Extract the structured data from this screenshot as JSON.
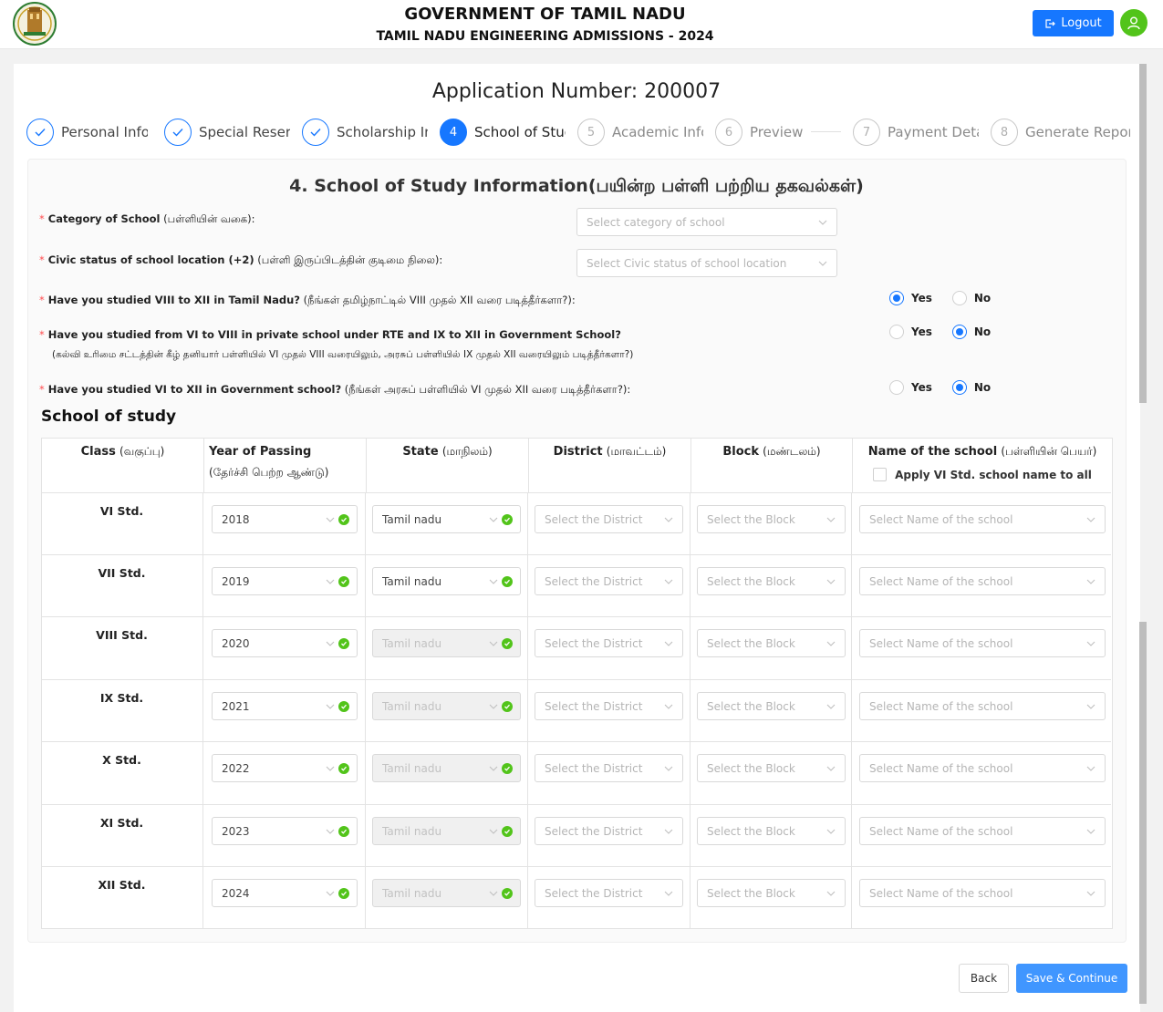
{
  "header": {
    "title": "GOVERNMENT OF TAMIL NADU",
    "subtitle": "TAMIL NADU ENGINEERING ADMISSIONS - 2024",
    "logout_label": "Logout"
  },
  "application_number": "Application Number: 200007",
  "steps": [
    {
      "number": "1",
      "label": "Personal Info",
      "status": "done"
    },
    {
      "number": "2",
      "label": "Special Reservation",
      "status": "done"
    },
    {
      "number": "3",
      "label": "Scholarship Info",
      "status": "done"
    },
    {
      "number": "4",
      "label": "School of Study",
      "status": "active"
    },
    {
      "number": "5",
      "label": "Academic Info",
      "status": "wait"
    },
    {
      "number": "6",
      "label": "Preview",
      "status": "wait"
    },
    {
      "number": "7",
      "label": "Payment Details",
      "status": "wait"
    },
    {
      "number": "8",
      "label": "Generate Report",
      "status": "wait"
    }
  ],
  "section_title": "4. School of Study Information(பயின்ற பள்ளி பற்றிய தகவல்கள்)",
  "questions": {
    "category": {
      "label_en": "Category of School",
      "label_ta": "(பள்ளியின் வகை):",
      "placeholder": "Select category of school"
    },
    "civic": {
      "label_en": "Civic status of school location (+2)",
      "label_ta": "(பள்ளி இருப்பிடத்தின் குடிமை நிலை):",
      "placeholder": "Select Civic status of school location"
    },
    "studied_tn": {
      "label_en": "Have you studied VIII to XII in Tamil Nadu?",
      "label_ta": "(நீங்கள் தமிழ்நாட்டில் VIII முதல் XII வரை படித்தீர்களா?):",
      "selected": "Yes"
    },
    "rte": {
      "label_en": "Have you studied from VI to VIII in private school under RTE and IX to XII in Government School?",
      "label_ta": "(கல்வி உரிமை சட்டத்தின் கீழ் தனியார் பள்ளியில் VI முதல் VIII வரையிலும், அரசுப் பள்ளியில் IX முதல் XII வரையிலும் படித்தீர்களா?)",
      "selected": "No"
    },
    "govt": {
      "label_en": "Have you studied VI to XII in Government school?",
      "label_ta": "(நீங்கள் அரசுப் பள்ளியில் VI முதல் XII வரை படித்தீர்களா?):",
      "selected": "No"
    },
    "yes_label": "Yes",
    "no_label": "No"
  },
  "school_of_study": {
    "title": "School of study",
    "headers": {
      "class_en": "Class",
      "class_ta": "(வகுப்பு)",
      "year_en": "Year of Passing",
      "year_ta": "(தேர்ச்சி பெற்ற ஆண்டு)",
      "state_en": "State",
      "state_ta": "(மாநிலம்)",
      "district_en": "District",
      "district_ta": "(மாவட்டம்)",
      "block_en": "Block",
      "block_ta": "(மண்டலம்)",
      "school_en": "Name of the school",
      "school_ta": "(பள்ளியின் பெயர்)",
      "apply_all": "Apply VI Std. school name to all"
    },
    "district_placeholder": "Select the District",
    "block_placeholder": "Select the Block",
    "school_placeholder": "Select Name of the school",
    "rows": [
      {
        "class": "VI Std.",
        "year": "2018",
        "state": "Tamil nadu",
        "state_enabled": true
      },
      {
        "class": "VII Std.",
        "year": "2019",
        "state": "Tamil nadu",
        "state_enabled": true
      },
      {
        "class": "VIII Std.",
        "year": "2020",
        "state": "Tamil nadu",
        "state_enabled": false
      },
      {
        "class": "IX Std.",
        "year": "2021",
        "state": "Tamil nadu",
        "state_enabled": false
      },
      {
        "class": "X Std.",
        "year": "2022",
        "state": "Tamil nadu",
        "state_enabled": false
      },
      {
        "class": "XI Std.",
        "year": "2023",
        "state": "Tamil nadu",
        "state_enabled": false
      },
      {
        "class": "XII Std.",
        "year": "2024",
        "state": "Tamil nadu",
        "state_enabled": false
      }
    ]
  },
  "buttons": {
    "back": "Back",
    "save": "Save & Continue"
  },
  "colors": {
    "primary": "#1677ff",
    "success": "#52c41a",
    "required": "#ff4d4f"
  }
}
